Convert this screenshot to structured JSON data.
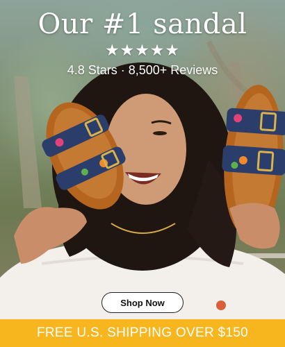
{
  "headline": "Our #1 sandal",
  "stars": "★★★★★",
  "rating_text": "4.8 Stars · 8,500+ Reviews",
  "cta_label": "Shop Now",
  "banner_text": "FREE U.S. SHIPPING OVER $150",
  "colors": {
    "banner": "#f7b51e",
    "cta_background": "#ffffff",
    "text_light": "#ffffff",
    "sandal_footbed": "#b5651d"
  }
}
